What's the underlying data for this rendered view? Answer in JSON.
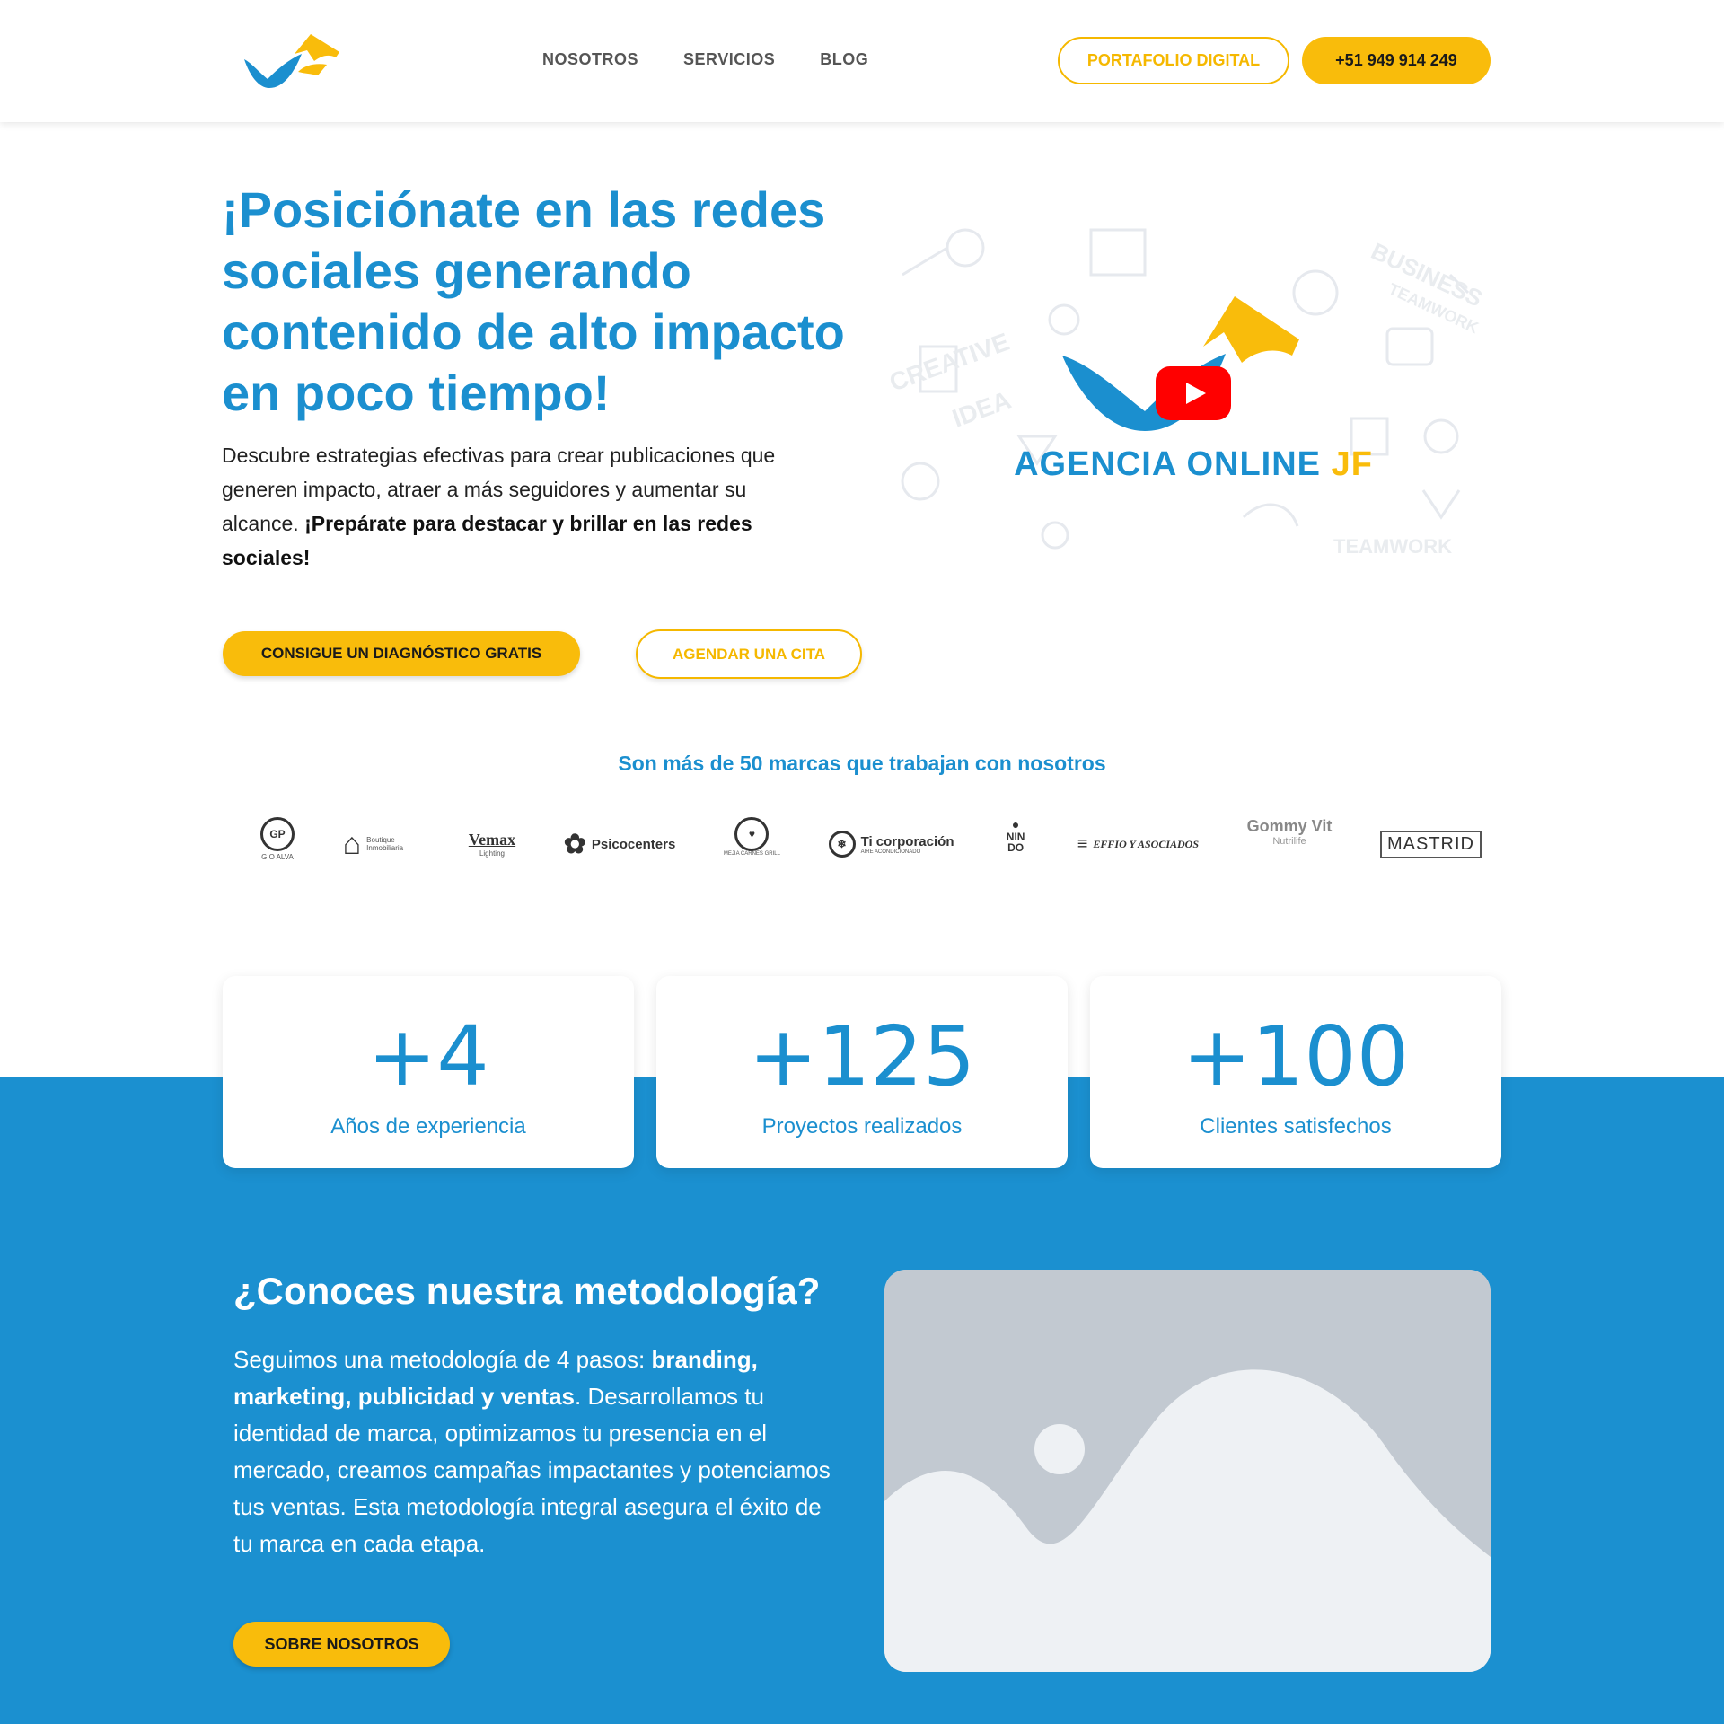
{
  "header": {
    "nav": [
      "NOSOTROS",
      "SERVICIOS",
      "BLOG"
    ],
    "portfolio_label": "PORTAFOLIO DIGITAL",
    "phone_label": "+51 949 914 249"
  },
  "hero": {
    "title": "¡Posiciónate en las redes sociales generando contenido de alto impacto en poco tiempo!",
    "desc_plain": "Descubre estrategias efectivas para crear publicaciones que generen impacto, atraer a más seguidores y aumentar su alcance. ",
    "desc_bold": "¡Prepárate para destacar y brillar en las redes sociales!",
    "btn_diag": "CONSIGUE UN DIAGNÓSTICO GRATIS",
    "btn_cita": "AGENDAR UNA CITA"
  },
  "video": {
    "caption_main": "AGENCIA ONLINE ",
    "caption_accent": "JF"
  },
  "brands": {
    "title": "Son más de 50 marcas que trabajan con nosotros",
    "items": [
      {
        "name": "GIO ALVA",
        "mark": "GP"
      },
      {
        "name": "Boutique Inmobiliaria",
        "mark": "⌂"
      },
      {
        "name": "Vemax",
        "sub": "Lighting"
      },
      {
        "name": "Psicocenters",
        "mark": "✿"
      },
      {
        "name": "MEJIA CARNES GRILL",
        "mark": "♥"
      },
      {
        "name": "Ti corporación",
        "sub": "AIRE ACONDICIONADO",
        "mark": "❄"
      },
      {
        "name": "NIN DO",
        "mark": "●"
      },
      {
        "name": "EFFIO Y ASOCIADOS",
        "mark": "≡"
      },
      {
        "name": "Gommy Vit",
        "sub": "Nutrilife"
      },
      {
        "name": "MASTRID"
      }
    ]
  },
  "stats": [
    {
      "value": "+4",
      "label": "Años de experiencia"
    },
    {
      "value": "+125",
      "label": "Proyectos realizados"
    },
    {
      "value": "+100",
      "label": "Clientes satisfechos"
    }
  ],
  "methodology": {
    "title": "¿Conoces nuestra metodología?",
    "text_1": "Seguimos una metodología de 4 pasos: ",
    "text_bold": "branding, marketing, publicidad y ventas",
    "text_2": ". Desarrollamos tu identidad de marca, optimizamos tu presencia en el mercado, creamos campañas impactantes y potenciamos tus ventas. Esta metodología integral asegura el éxito de tu marca en cada etapa.",
    "button": "SOBRE NOSOTROS"
  },
  "colors": {
    "brand_blue": "#1b8fcf",
    "section_blue": "#1b90d0",
    "accent_yellow": "#f9bc0b",
    "youtube_red": "#ff0000"
  }
}
